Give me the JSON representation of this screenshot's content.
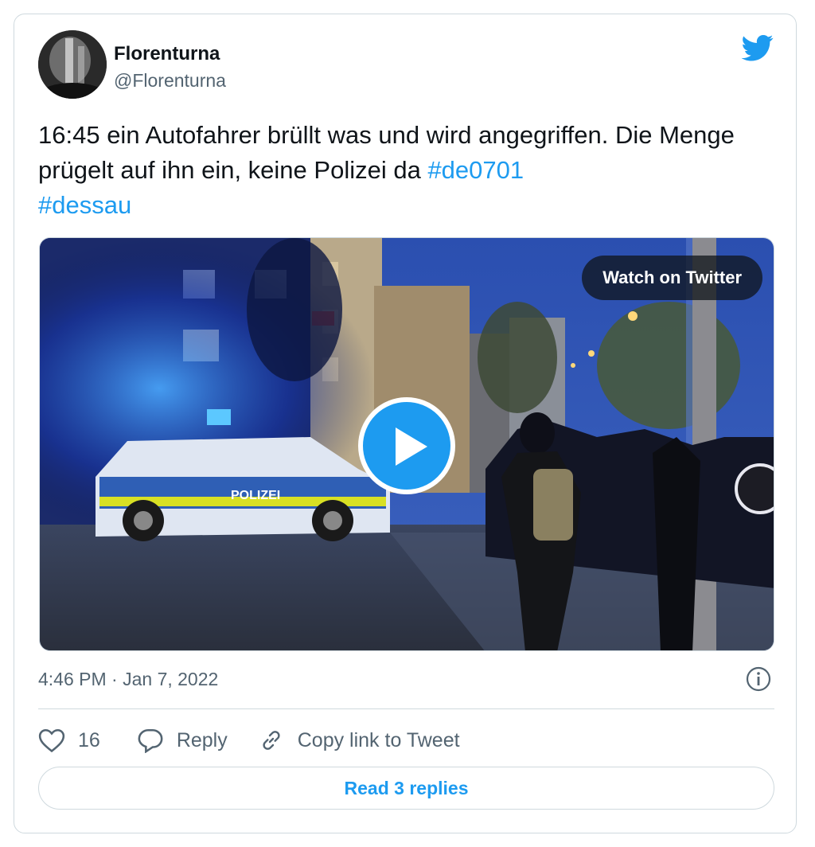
{
  "author": {
    "display_name": "Florenturna",
    "handle": "@Florenturna"
  },
  "tweet": {
    "text": "16:45 ein Autofahrer brüllt was und wird angegriffen. Die Menge prügelt auf ihn ein, keine Polizei da ",
    "hashtags": [
      "#de0701",
      "#dessau"
    ],
    "timestamp": "4:46 PM · Jan 7, 2022"
  },
  "media": {
    "watch_label": "Watch on Twitter",
    "car_text": "POLIZEI"
  },
  "actions": {
    "like_count": "16",
    "reply_label": "Reply",
    "copy_link_label": "Copy link to Tweet"
  },
  "read_replies_label": "Read 3 replies",
  "colors": {
    "accent": "#1d9bf0",
    "text": "#0f1419",
    "secondary": "#536471",
    "border": "#cfd9de"
  },
  "icons": [
    "twitter-bird-icon",
    "play-icon",
    "info-icon",
    "heart-icon",
    "reply-bubble-icon",
    "link-icon"
  ]
}
